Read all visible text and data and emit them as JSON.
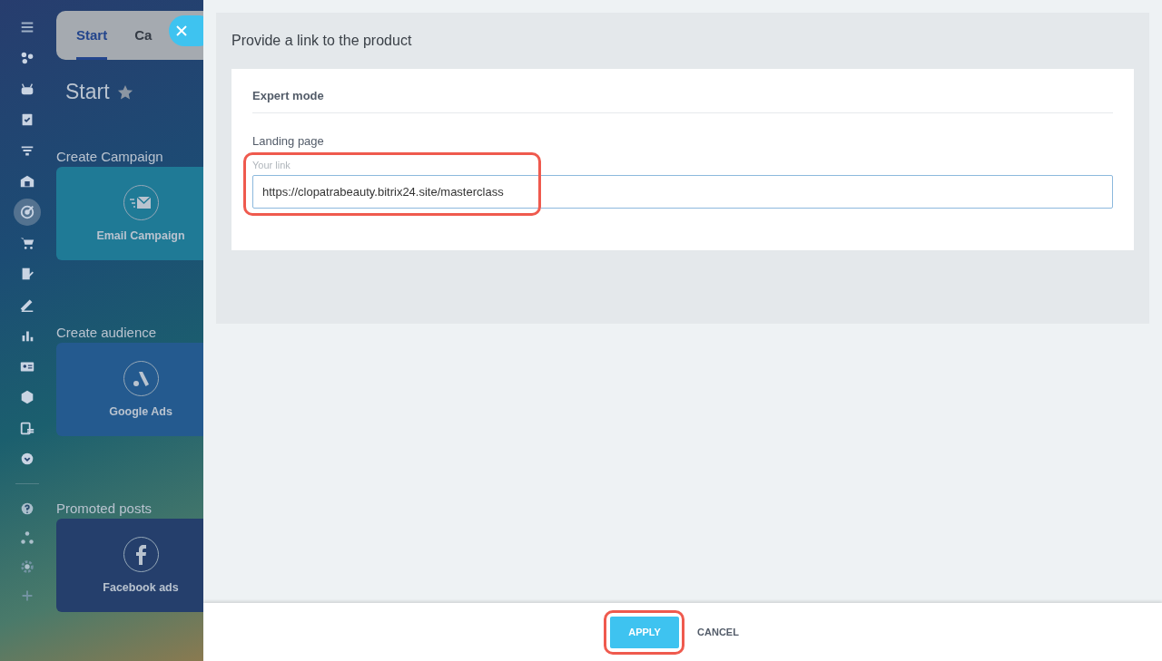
{
  "sidebar": {
    "items": [
      {
        "selected": false
      },
      {
        "selected": false
      },
      {
        "selected": false
      },
      {
        "selected": false
      },
      {
        "selected": false
      },
      {
        "selected": false
      },
      {
        "selected": true
      },
      {
        "selected": false
      },
      {
        "selected": false
      },
      {
        "selected": false
      },
      {
        "selected": false
      },
      {
        "selected": false
      },
      {
        "selected": false
      },
      {
        "selected": false
      },
      {
        "selected": false
      }
    ],
    "footer_items": [
      {
        "selected": false
      },
      {
        "selected": false
      },
      {
        "selected": false
      },
      {
        "selected": false
      }
    ]
  },
  "page": {
    "tabs": [
      {
        "label": "Start",
        "selected": true
      },
      {
        "label": "Ca",
        "selected": false
      }
    ],
    "title": "Start",
    "sections": [
      {
        "heading": "Create Campaign",
        "card": {
          "label": "Email Campaign",
          "color": "#1f7a96"
        }
      },
      {
        "heading": "Create audience",
        "card": {
          "label": "Google Ads",
          "color": "#245a8f"
        }
      },
      {
        "heading": "Promoted posts",
        "card": {
          "label": "Facebook ads",
          "color": "#253f6c"
        }
      }
    ]
  },
  "slider": {
    "title": "Provide a link to the product",
    "section_title": "Expert mode",
    "field": {
      "label": "Landing page",
      "placeholder": "Your link",
      "value": "https://clopatrabeauty.bitrix24.site/masterclass",
      "highlighted": true
    },
    "buttons": [
      {
        "label": "APPLY",
        "kind": "primary",
        "highlighted": true
      },
      {
        "label": "CANCEL",
        "kind": "link",
        "highlighted": false
      }
    ]
  }
}
